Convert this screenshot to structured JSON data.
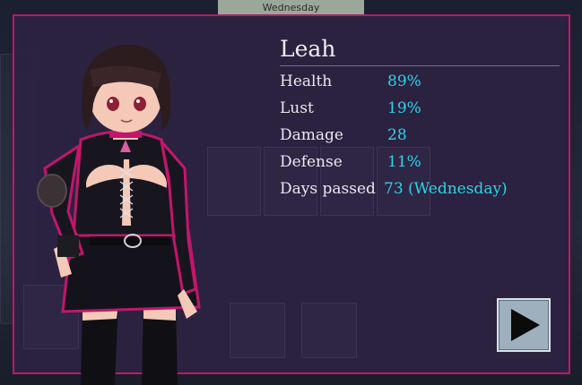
{
  "header": {
    "day_label": "Wednesday"
  },
  "character": {
    "name": "Leah",
    "stats": [
      {
        "label": "Health",
        "value": "89%"
      },
      {
        "label": "Lust",
        "value": "19%"
      },
      {
        "label": "Damage",
        "value": "28"
      },
      {
        "label": "Defense",
        "value": "11%"
      },
      {
        "label": "Days passed",
        "value": "73 (Wednesday)"
      }
    ]
  },
  "controls": {
    "next_icon": "play-triangle-icon"
  },
  "colors": {
    "accent_border": "#c2166a",
    "stat_value": "#2fd3e6",
    "panel_bg": "#2c2242"
  }
}
